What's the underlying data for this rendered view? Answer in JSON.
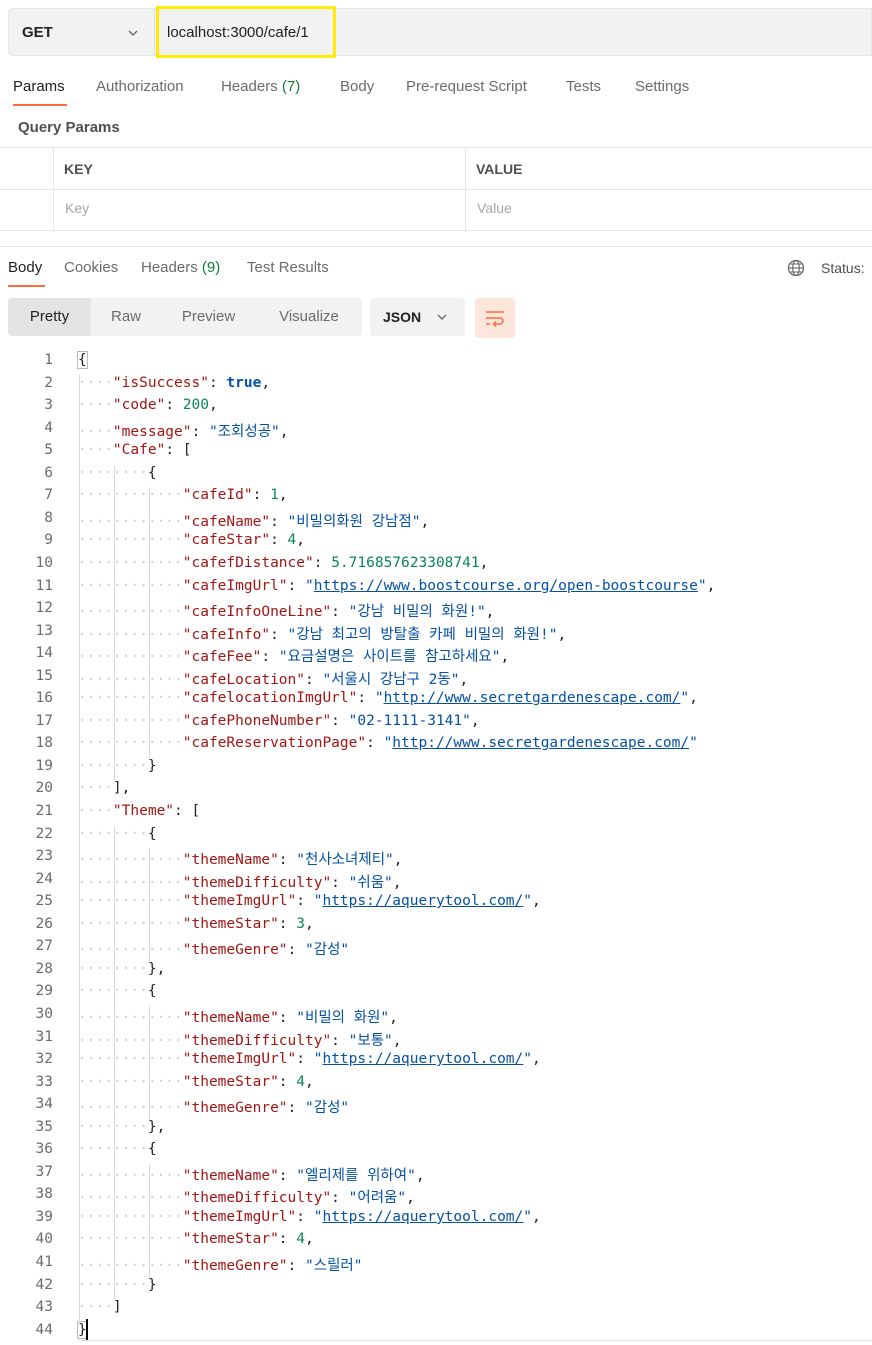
{
  "request": {
    "method": "GET",
    "url": "localhost:3000/cafe/1"
  },
  "request_tabs": [
    {
      "label": "Params",
      "count": ""
    },
    {
      "label": "Authorization",
      "count": ""
    },
    {
      "label": "Headers",
      "count": "(7)"
    },
    {
      "label": "Body",
      "count": ""
    },
    {
      "label": "Pre-request Script",
      "count": ""
    },
    {
      "label": "Tests",
      "count": ""
    },
    {
      "label": "Settings",
      "count": ""
    }
  ],
  "query_params": {
    "title": "Query Params",
    "key_header": "KEY",
    "value_header": "VALUE",
    "key_placeholder": "Key",
    "value_placeholder": "Value"
  },
  "response_tabs": [
    {
      "label": "Body",
      "count": ""
    },
    {
      "label": "Cookies",
      "count": ""
    },
    {
      "label": "Headers",
      "count": "(9)"
    },
    {
      "label": "Test Results",
      "count": ""
    }
  ],
  "status_label": "Status:",
  "view_modes": [
    "Pretty",
    "Raw",
    "Preview",
    "Visualize"
  ],
  "format": "JSON",
  "colors": {
    "accent": "#ff6c37",
    "count": "#0f7d3a",
    "url_highlight": "#ffea0a"
  },
  "icons": {
    "globe": "globe-icon",
    "wrap": "wrap-lines-icon",
    "chevron": "chevron-down-icon"
  },
  "code_lines": [
    {
      "n": "1",
      "d": 0,
      "t": [
        [
          "p",
          "{"
        ]
      ]
    },
    {
      "n": "2",
      "d": 1,
      "t": [
        [
          "k",
          "\"isSuccess\""
        ],
        [
          "p",
          ": "
        ],
        [
          "b",
          "true"
        ],
        [
          "p",
          ","
        ]
      ]
    },
    {
      "n": "3",
      "d": 1,
      "t": [
        [
          "k",
          "\"code\""
        ],
        [
          "p",
          ": "
        ],
        [
          "n",
          "200"
        ],
        [
          "p",
          ","
        ]
      ]
    },
    {
      "n": "4",
      "d": 1,
      "t": [
        [
          "k",
          "\"message\""
        ],
        [
          "p",
          ": "
        ],
        [
          "s",
          "\"조회성공\""
        ],
        [
          "p",
          ","
        ]
      ]
    },
    {
      "n": "5",
      "d": 1,
      "t": [
        [
          "k",
          "\"Cafe\""
        ],
        [
          "p",
          ": ["
        ]
      ]
    },
    {
      "n": "6",
      "d": 2,
      "t": [
        [
          "p",
          "{"
        ]
      ]
    },
    {
      "n": "7",
      "d": 3,
      "t": [
        [
          "k",
          "\"cafeId\""
        ],
        [
          "p",
          ": "
        ],
        [
          "n",
          "1"
        ],
        [
          "p",
          ","
        ]
      ]
    },
    {
      "n": "8",
      "d": 3,
      "t": [
        [
          "k",
          "\"cafeName\""
        ],
        [
          "p",
          ": "
        ],
        [
          "s",
          "\"비밀의화원 강남점\""
        ],
        [
          "p",
          ","
        ]
      ]
    },
    {
      "n": "9",
      "d": 3,
      "t": [
        [
          "k",
          "\"cafeStar\""
        ],
        [
          "p",
          ": "
        ],
        [
          "n",
          "4"
        ],
        [
          "p",
          ","
        ]
      ]
    },
    {
      "n": "10",
      "d": 3,
      "t": [
        [
          "k",
          "\"cafefDistance\""
        ],
        [
          "p",
          ": "
        ],
        [
          "n",
          "5.716857623308741"
        ],
        [
          "p",
          ","
        ]
      ]
    },
    {
      "n": "11",
      "d": 3,
      "t": [
        [
          "k",
          "\"cafeImgUrl\""
        ],
        [
          "p",
          ": "
        ],
        [
          "s",
          "\""
        ],
        [
          "u",
          "https://www.boostcourse.org/open-boostcourse"
        ],
        [
          "s",
          "\""
        ],
        [
          "p",
          ","
        ]
      ]
    },
    {
      "n": "12",
      "d": 3,
      "t": [
        [
          "k",
          "\"cafeInfoOneLine\""
        ],
        [
          "p",
          ": "
        ],
        [
          "s",
          "\"강남 비밀의 화원!\""
        ],
        [
          "p",
          ","
        ]
      ]
    },
    {
      "n": "13",
      "d": 3,
      "t": [
        [
          "k",
          "\"cafeInfo\""
        ],
        [
          "p",
          ": "
        ],
        [
          "s",
          "\"강남 최고의 방탈출 카페 비밀의 화원!\""
        ],
        [
          "p",
          ","
        ]
      ]
    },
    {
      "n": "14",
      "d": 3,
      "t": [
        [
          "k",
          "\"cafeFee\""
        ],
        [
          "p",
          ": "
        ],
        [
          "s",
          "\"요금설명은 사이트를 참고하세요\""
        ],
        [
          "p",
          ","
        ]
      ]
    },
    {
      "n": "15",
      "d": 3,
      "t": [
        [
          "k",
          "\"cafeLocation\""
        ],
        [
          "p",
          ": "
        ],
        [
          "s",
          "\"서울시 강남구 2동\""
        ],
        [
          "p",
          ","
        ]
      ]
    },
    {
      "n": "16",
      "d": 3,
      "t": [
        [
          "k",
          "\"cafelocationImgUrl\""
        ],
        [
          "p",
          ": "
        ],
        [
          "s",
          "\""
        ],
        [
          "u",
          "http://www.secretgardenescape.com/"
        ],
        [
          "s",
          "\""
        ],
        [
          "p",
          ","
        ]
      ]
    },
    {
      "n": "17",
      "d": 3,
      "t": [
        [
          "k",
          "\"cafePhoneNumber\""
        ],
        [
          "p",
          ": "
        ],
        [
          "s",
          "\"02-1111-3141\""
        ],
        [
          "p",
          ","
        ]
      ]
    },
    {
      "n": "18",
      "d": 3,
      "t": [
        [
          "k",
          "\"cafeReservationPage\""
        ],
        [
          "p",
          ": "
        ],
        [
          "s",
          "\""
        ],
        [
          "u",
          "http://www.secretgardenescape.com/"
        ],
        [
          "s",
          "\""
        ]
      ]
    },
    {
      "n": "19",
      "d": 2,
      "t": [
        [
          "p",
          "}"
        ]
      ]
    },
    {
      "n": "20",
      "d": 1,
      "t": [
        [
          "p",
          "],"
        ]
      ]
    },
    {
      "n": "21",
      "d": 1,
      "t": [
        [
          "k",
          "\"Theme\""
        ],
        [
          "p",
          ": ["
        ]
      ]
    },
    {
      "n": "22",
      "d": 2,
      "t": [
        [
          "p",
          "{"
        ]
      ]
    },
    {
      "n": "23",
      "d": 3,
      "t": [
        [
          "k",
          "\"themeName\""
        ],
        [
          "p",
          ": "
        ],
        [
          "s",
          "\"천사소녀제티\""
        ],
        [
          "p",
          ","
        ]
      ]
    },
    {
      "n": "24",
      "d": 3,
      "t": [
        [
          "k",
          "\"themeDifficulty\""
        ],
        [
          "p",
          ": "
        ],
        [
          "s",
          "\"쉬움\""
        ],
        [
          "p",
          ","
        ]
      ]
    },
    {
      "n": "25",
      "d": 3,
      "t": [
        [
          "k",
          "\"themeImgUrl\""
        ],
        [
          "p",
          ": "
        ],
        [
          "s",
          "\""
        ],
        [
          "u",
          "https://aquerytool.com/"
        ],
        [
          "s",
          "\""
        ],
        [
          "p",
          ","
        ]
      ]
    },
    {
      "n": "26",
      "d": 3,
      "t": [
        [
          "k",
          "\"themeStar\""
        ],
        [
          "p",
          ": "
        ],
        [
          "n",
          "3"
        ],
        [
          "p",
          ","
        ]
      ]
    },
    {
      "n": "27",
      "d": 3,
      "t": [
        [
          "k",
          "\"themeGenre\""
        ],
        [
          "p",
          ": "
        ],
        [
          "s",
          "\"감성\""
        ]
      ]
    },
    {
      "n": "28",
      "d": 2,
      "t": [
        [
          "p",
          "},"
        ]
      ]
    },
    {
      "n": "29",
      "d": 2,
      "t": [
        [
          "p",
          "{"
        ]
      ]
    },
    {
      "n": "30",
      "d": 3,
      "t": [
        [
          "k",
          "\"themeName\""
        ],
        [
          "p",
          ": "
        ],
        [
          "s",
          "\"비밀의 화원\""
        ],
        [
          "p",
          ","
        ]
      ]
    },
    {
      "n": "31",
      "d": 3,
      "t": [
        [
          "k",
          "\"themeDifficulty\""
        ],
        [
          "p",
          ": "
        ],
        [
          "s",
          "\"보통\""
        ],
        [
          "p",
          ","
        ]
      ]
    },
    {
      "n": "32",
      "d": 3,
      "t": [
        [
          "k",
          "\"themeImgUrl\""
        ],
        [
          "p",
          ": "
        ],
        [
          "s",
          "\""
        ],
        [
          "u",
          "https://aquerytool.com/"
        ],
        [
          "s",
          "\""
        ],
        [
          "p",
          ","
        ]
      ]
    },
    {
      "n": "33",
      "d": 3,
      "t": [
        [
          "k",
          "\"themeStar\""
        ],
        [
          "p",
          ": "
        ],
        [
          "n",
          "4"
        ],
        [
          "p",
          ","
        ]
      ]
    },
    {
      "n": "34",
      "d": 3,
      "t": [
        [
          "k",
          "\"themeGenre\""
        ],
        [
          "p",
          ": "
        ],
        [
          "s",
          "\"감성\""
        ]
      ]
    },
    {
      "n": "35",
      "d": 2,
      "t": [
        [
          "p",
          "},"
        ]
      ]
    },
    {
      "n": "36",
      "d": 2,
      "t": [
        [
          "p",
          "{"
        ]
      ]
    },
    {
      "n": "37",
      "d": 3,
      "t": [
        [
          "k",
          "\"themeName\""
        ],
        [
          "p",
          ": "
        ],
        [
          "s",
          "\"엘리제를 위하여\""
        ],
        [
          "p",
          ","
        ]
      ]
    },
    {
      "n": "38",
      "d": 3,
      "t": [
        [
          "k",
          "\"themeDifficulty\""
        ],
        [
          "p",
          ": "
        ],
        [
          "s",
          "\"어려움\""
        ],
        [
          "p",
          ","
        ]
      ]
    },
    {
      "n": "39",
      "d": 3,
      "t": [
        [
          "k",
          "\"themeImgUrl\""
        ],
        [
          "p",
          ": "
        ],
        [
          "s",
          "\""
        ],
        [
          "u",
          "https://aquerytool.com/"
        ],
        [
          "s",
          "\""
        ],
        [
          "p",
          ","
        ]
      ]
    },
    {
      "n": "40",
      "d": 3,
      "t": [
        [
          "k",
          "\"themeStar\""
        ],
        [
          "p",
          ": "
        ],
        [
          "n",
          "4"
        ],
        [
          "p",
          ","
        ]
      ]
    },
    {
      "n": "41",
      "d": 3,
      "t": [
        [
          "k",
          "\"themeGenre\""
        ],
        [
          "p",
          ": "
        ],
        [
          "s",
          "\"스릴러\""
        ]
      ]
    },
    {
      "n": "42",
      "d": 2,
      "t": [
        [
          "p",
          "}"
        ]
      ]
    },
    {
      "n": "43",
      "d": 1,
      "t": [
        [
          "p",
          "]"
        ]
      ]
    },
    {
      "n": "44",
      "d": 0,
      "t": [
        [
          "p",
          "}"
        ]
      ]
    }
  ]
}
